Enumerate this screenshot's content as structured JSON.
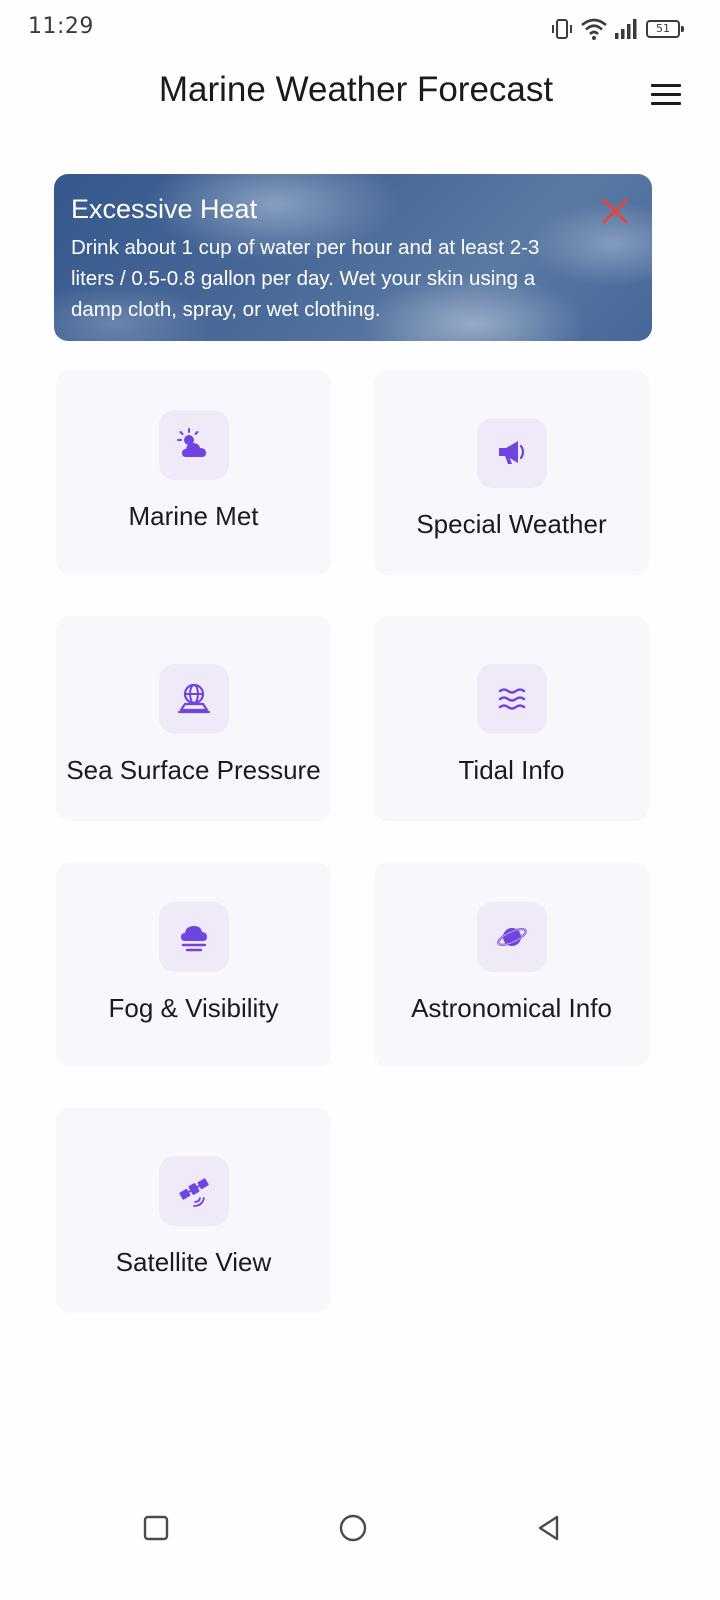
{
  "status_bar": {
    "time": "11:29",
    "battery_level": "51",
    "icons": [
      "vibrate-icon",
      "wifi-icon",
      "signal-icon",
      "battery-icon"
    ]
  },
  "app_bar": {
    "title": "Marine Weather Forecast",
    "menu_icon": "hamburger-menu-icon"
  },
  "alert": {
    "title": "Excessive Heat",
    "line_1": "Drink about 1 cup of water per hour and at least 2-3",
    "line_2": "liters / 0.5-0.8 gallon per day. Wet your skin using a",
    "line_3": "damp cloth, spray, or wet clothing.",
    "close_icon": "close-icon",
    "close_color": "#e5443b"
  },
  "menu": {
    "accent_color": "#7044e0",
    "items": [
      {
        "label": "Marine Met",
        "icon": "partly-cloudy-icon"
      },
      {
        "label": "Special Weather",
        "icon": "megaphone-icon"
      },
      {
        "label": "Sea Surface Pressure",
        "icon": "globe-pressure-icon"
      },
      {
        "label": "Tidal Info",
        "icon": "waves-icon"
      },
      {
        "label": "Fog & Visibility",
        "icon": "fog-icon"
      },
      {
        "label": "Astronomical Info",
        "icon": "planet-icon"
      },
      {
        "label": "Satellite View",
        "icon": "satellite-icon"
      }
    ]
  },
  "nav_bar": {
    "items": [
      "recents-icon",
      "home-icon",
      "back-icon"
    ]
  }
}
